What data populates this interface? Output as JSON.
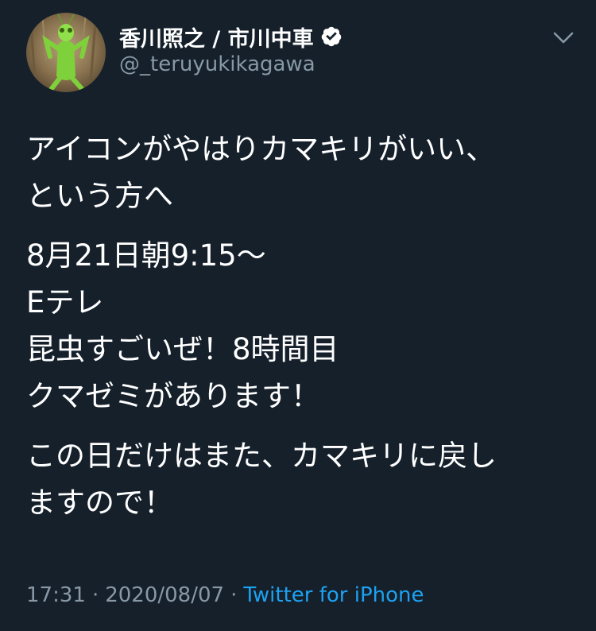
{
  "author": {
    "display_name": "香川照之 / 市川中車",
    "handle": "@_teruyukikagawa",
    "verified": true,
    "avatar_icon": "mantis-costume-avatar"
  },
  "menu_icon": "chevron-down-icon",
  "tweet": {
    "paragraphs": [
      [
        "アイコンがやはりカマキリがいい、",
        "という方へ"
      ],
      [
        "8月21日朝9:15〜",
        "Eテレ",
        "昆虫すごいぜ！8時間目",
        "クマゼミがあります！"
      ],
      [
        "この日だけはまた、カマキリに戻し",
        "ますので！"
      ]
    ]
  },
  "meta": {
    "time": "17:31",
    "separator": "·",
    "date": "2020/08/07",
    "source": "Twitter for iPhone"
  },
  "colors": {
    "background": "#15202b",
    "text": "#ffffff",
    "secondary": "#8899a6",
    "link": "#1da1f2"
  }
}
